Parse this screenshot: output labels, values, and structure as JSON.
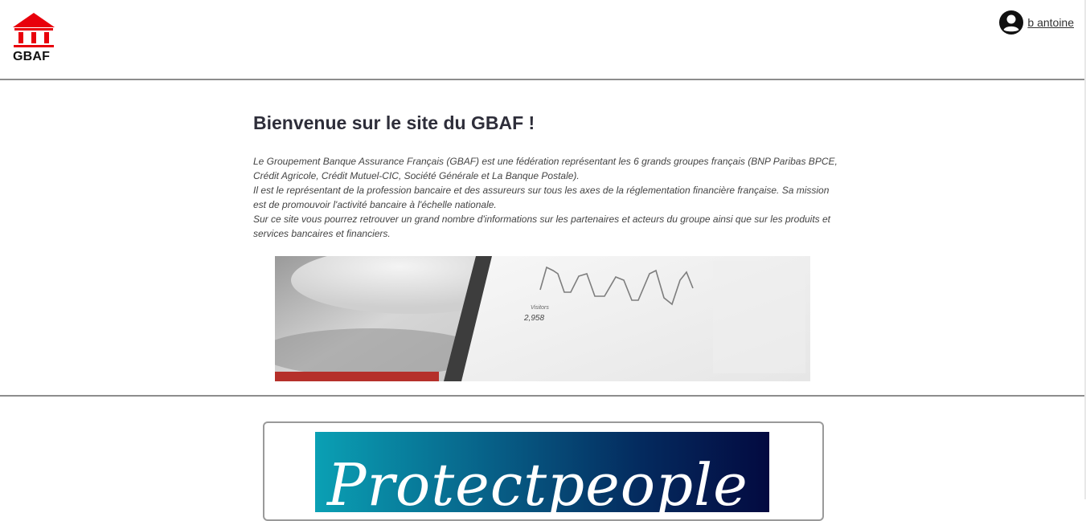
{
  "header": {
    "logo_text": "GBAF",
    "user_name": "b antoine",
    "icons": {
      "logo": "bank-building-icon",
      "user": "account-circle-icon"
    }
  },
  "colors": {
    "brand_red": "#e8000b",
    "banner_red": "#b5302a",
    "divider": "#8d8d8d"
  },
  "main": {
    "title": "Bienvenue sur le site du GBAF !",
    "paragraphs": [
      "Le Groupement Banque Assurance Français (GBAF) est une fédération représentant les 6 grands groupes français (BNP Paribas BPCE, Crédit Agricole, Crédit Mutuel-CIC, Société Générale et La Banque Postale).",
      "Il est le représentant de la profession bancaire et des assureurs sur tous les axes de la réglementation financière française. Sa mission est de promouvoir l'activité bancaire à l'échelle nationale.",
      "Sur ce site vous pourrez retrouver un grand nombre d'informations sur les partenaires et acteurs du groupe ainsi que sur les produits et services bancaires et financiers."
    ],
    "banner": {
      "visitors_label": "Visitors",
      "visitors_value": "2,958"
    }
  },
  "partners": [
    {
      "logo_text": "Protectpeople"
    }
  ]
}
